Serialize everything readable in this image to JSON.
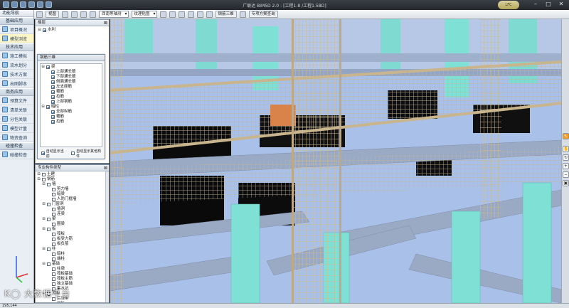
{
  "window": {
    "title": "广联达 BIM5D 2.0 - [工程1-8 /工程1.5BD]",
    "user_badge": "LFC",
    "buttons": {
      "minimize": "–",
      "maximize": "□",
      "close": "✕"
    }
  },
  "leftnav": {
    "header": "功能导航",
    "groups": [
      {
        "label": "基础应用",
        "items": [
          {
            "label": "项目概况",
            "icon": "project-icon"
          },
          {
            "label": "模型浏览",
            "icon": "model-icon",
            "active": true
          }
        ]
      },
      {
        "label": "技术应用",
        "items": [
          {
            "label": "施工模拟",
            "icon": "simulation-icon"
          },
          {
            "label": "流水划分",
            "icon": "flow-icon"
          },
          {
            "label": "技术方案",
            "icon": "plan-icon"
          },
          {
            "label": "出图脚本",
            "icon": "script-icon"
          }
        ]
      },
      {
        "label": "商务应用",
        "items": [
          {
            "label": "预算文件",
            "icon": "budget-icon"
          },
          {
            "label": "清单关联",
            "icon": "list-icon"
          },
          {
            "label": "分包关联",
            "icon": "subcontract-icon"
          },
          {
            "label": "模型计量",
            "icon": "measure-icon"
          },
          {
            "label": "物资查询",
            "icon": "material-icon"
          }
        ]
      },
      {
        "label": "碰撞检查",
        "items": [
          {
            "label": "碰撞检查",
            "icon": "collision-icon"
          }
        ]
      }
    ]
  },
  "toolbar": {
    "view_label": "视图",
    "view_mode": "西南等轴测",
    "shade_mode": "纹理贴图",
    "rebar_3d": "钢筋三维",
    "plan_query": "专项方案查询"
  },
  "layer_panel": {
    "title": "楼层",
    "root": "水利"
  },
  "rebar_dialog": {
    "title": "钢筋三维",
    "tree": [
      {
        "label": "梁",
        "level": 0,
        "checked": true,
        "expand": "⊟"
      },
      {
        "label": "上部通长筋",
        "level": 1,
        "checked": true
      },
      {
        "label": "下部通长筋",
        "level": 1,
        "checked": true
      },
      {
        "label": "侧面通长筋",
        "level": 1,
        "checked": true
      },
      {
        "label": "左支座筋",
        "level": 1,
        "checked": true
      },
      {
        "label": "箍筋",
        "level": 1,
        "checked": true
      },
      {
        "label": "拉筋",
        "level": 1,
        "checked": true
      },
      {
        "label": "上部钢筋",
        "level": 1,
        "checked": true
      },
      {
        "label": "暗柱",
        "level": 0,
        "checked": true,
        "expand": "⊟"
      },
      {
        "label": "全部纵筋",
        "level": 1,
        "checked": true
      },
      {
        "label": "箍筋",
        "level": 1,
        "checked": true
      },
      {
        "label": "拉筋",
        "level": 1,
        "checked": true
      }
    ],
    "footer_left": "自动显示当前",
    "footer_right": "自动显示其他构件"
  },
  "type_panel": {
    "title": "专业构件类型",
    "tree": [
      {
        "label": "土建",
        "level": 0,
        "expand": "⊟"
      },
      {
        "label": "钢筋",
        "level": 0,
        "expand": "⊟"
      },
      {
        "label": "墙",
        "level": 1,
        "expand": "⊟"
      },
      {
        "label": "剪力墙",
        "level": 2
      },
      {
        "label": "暗梁",
        "level": 2
      },
      {
        "label": "人防门框墙",
        "level": 2
      },
      {
        "label": "门窗洞",
        "level": 1,
        "expand": "⊟"
      },
      {
        "label": "墙洞",
        "level": 2
      },
      {
        "label": "连梁",
        "level": 2
      },
      {
        "label": "梁",
        "level": 1,
        "expand": "⊟"
      },
      {
        "label": "圈梁",
        "level": 2
      },
      {
        "label": "板",
        "level": 1,
        "expand": "⊟"
      },
      {
        "label": "筏板",
        "level": 2
      },
      {
        "label": "板受力筋",
        "level": 2
      },
      {
        "label": "板负筋",
        "level": 2
      },
      {
        "label": "柱",
        "level": 1,
        "expand": "⊟"
      },
      {
        "label": "暗柱",
        "level": 2
      },
      {
        "label": "端柱",
        "level": 2
      },
      {
        "label": "基础",
        "level": 1,
        "expand": "⊟"
      },
      {
        "label": "柱墩",
        "level": 2
      },
      {
        "label": "筏板基础",
        "level": 2
      },
      {
        "label": "筏板主筋",
        "level": 2
      },
      {
        "label": "独立基础",
        "level": 2
      },
      {
        "label": "集水坑",
        "level": 2
      },
      {
        "label": "其他",
        "level": 1,
        "expand": "⊟"
      },
      {
        "label": "后浇带",
        "level": 2
      },
      {
        "label": "栏板",
        "level": 2
      },
      {
        "label": "压顶",
        "level": 2
      }
    ]
  },
  "right_tools": [
    {
      "name": "select-tool-icon",
      "glyph": "↖"
    },
    {
      "name": "pan-tool-icon",
      "glyph": "✋"
    },
    {
      "name": "rotate-tool-icon",
      "glyph": "↻"
    },
    {
      "name": "zoom-in-icon",
      "glyph": "+"
    },
    {
      "name": "zoom-out-icon",
      "glyph": "−"
    },
    {
      "name": "fit-view-icon",
      "glyph": "▣"
    }
  ],
  "statusbar": {
    "text": "195,144"
  },
  "watermark": "K◯ 大数据平台",
  "colors": {
    "sky": "#a9c1e8",
    "concrete": "#7fe0d6",
    "beam": "#9aa9c4",
    "rebar": "#c8b99a",
    "highlight": "#d9824a"
  }
}
